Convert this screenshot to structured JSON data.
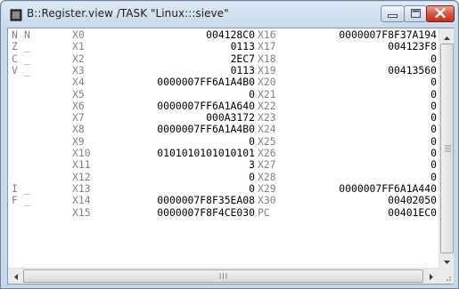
{
  "window": {
    "title": "B::Register.view /TASK \"Linux:::sieve\""
  },
  "colors": {
    "label_gray": "#808080",
    "value_black": "#000000",
    "close_red": "#c7402a",
    "titlebar": "#c5d7ea"
  },
  "icons": {
    "app": "chip-icon",
    "minimize": "minimize-icon",
    "maximize": "maximize-icon",
    "close": "close-icon"
  },
  "rows": [
    {
      "flag": "N",
      "flag_val": "N",
      "left_reg": "X0",
      "left_val": "004128C0",
      "right_reg": "X16",
      "right_val": "0000007F8F37A194"
    },
    {
      "flag": "Z",
      "flag_val": "_",
      "left_reg": "X1",
      "left_val": "0113",
      "right_reg": "X17",
      "right_val": "004123F8"
    },
    {
      "flag": "C",
      "flag_val": "_",
      "left_reg": "X2",
      "left_val": "2EC7",
      "right_reg": "X18",
      "right_val": "0"
    },
    {
      "flag": "V",
      "flag_val": "_",
      "left_reg": "X3",
      "left_val": "0113",
      "right_reg": "X19",
      "right_val": "00413560"
    },
    {
      "flag": "",
      "flag_val": "",
      "left_reg": "X4",
      "left_val": "0000007FF6A1A4B0",
      "right_reg": "X20",
      "right_val": "0"
    },
    {
      "flag": "",
      "flag_val": "",
      "left_reg": "X5",
      "left_val": "0",
      "right_reg": "X21",
      "right_val": "0"
    },
    {
      "flag": "",
      "flag_val": "",
      "left_reg": "X6",
      "left_val": "0000007FF6A1A640",
      "right_reg": "X22",
      "right_val": "0"
    },
    {
      "flag": "",
      "flag_val": "",
      "left_reg": "X7",
      "left_val": "000A3172",
      "right_reg": "X23",
      "right_val": "0"
    },
    {
      "flag": "",
      "flag_val": "",
      "left_reg": "X8",
      "left_val": "0000007FF6A1A4B0",
      "right_reg": "X24",
      "right_val": "0"
    },
    {
      "flag": "",
      "flag_val": "",
      "left_reg": "X9",
      "left_val": "0",
      "right_reg": "X25",
      "right_val": "0"
    },
    {
      "flag": "",
      "flag_val": "",
      "left_reg": "X10",
      "left_val": "0101010101010101",
      "right_reg": "X26",
      "right_val": "0"
    },
    {
      "flag": "",
      "flag_val": "",
      "left_reg": "X11",
      "left_val": "3",
      "right_reg": "X27",
      "right_val": "0"
    },
    {
      "flag": "",
      "flag_val": "",
      "left_reg": "X12",
      "left_val": "0",
      "right_reg": "X28",
      "right_val": "0"
    },
    {
      "flag": "I",
      "flag_val": "_",
      "left_reg": "X13",
      "left_val": "0",
      "right_reg": "X29",
      "right_val": "0000007FF6A1A440"
    },
    {
      "flag": "F",
      "flag_val": "_",
      "left_reg": "X14",
      "left_val": "0000007F8F35EA08",
      "right_reg": "X30",
      "right_val": "00402050"
    },
    {
      "flag": "",
      "flag_val": "",
      "left_reg": "X15",
      "left_val": "0000007F8F4CE030",
      "right_reg": "PC",
      "right_val": "00401EC0"
    }
  ]
}
